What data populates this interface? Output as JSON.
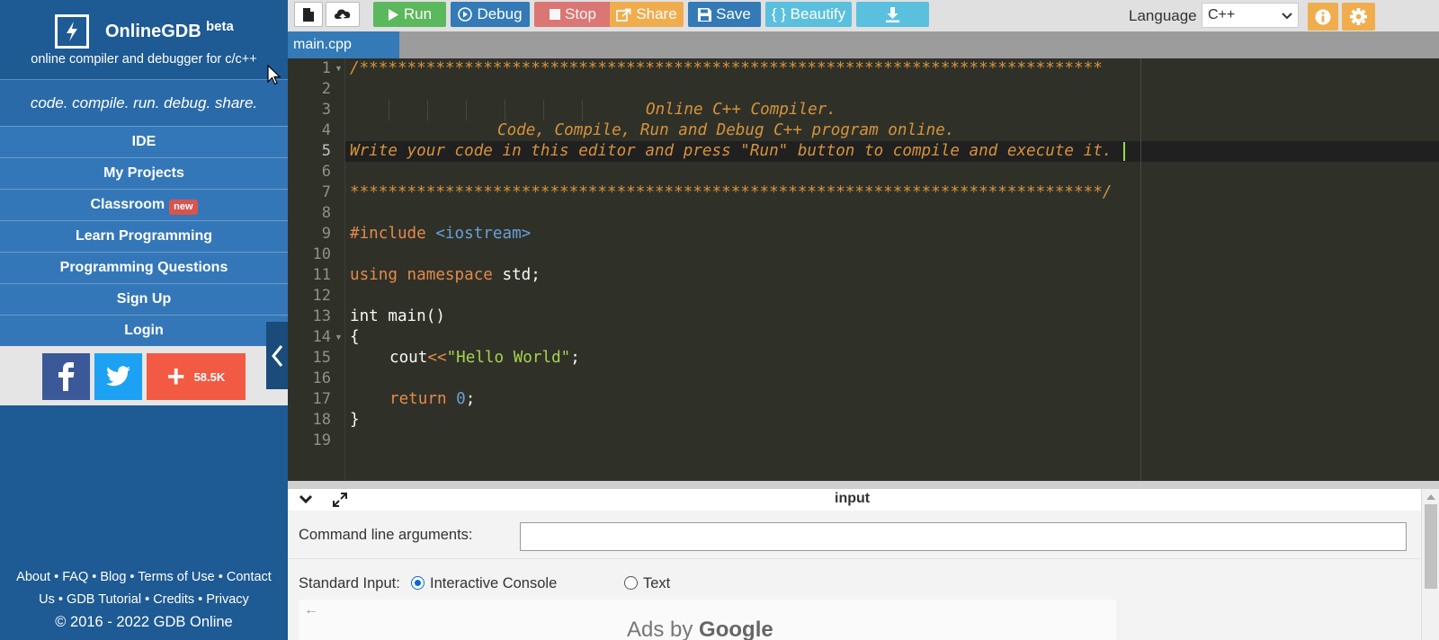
{
  "brand": {
    "name": "OnlineGDB",
    "beta": "beta",
    "tagline": "online compiler and debugger for c/c++",
    "slogan": "code. compile. run. debug. share."
  },
  "nav": {
    "items": [
      {
        "label": "IDE"
      },
      {
        "label": "My Projects"
      },
      {
        "label": "Classroom",
        "badge": "new"
      },
      {
        "label": "Learn Programming"
      },
      {
        "label": "Programming Questions"
      },
      {
        "label": "Sign Up"
      },
      {
        "label": "Login"
      }
    ]
  },
  "social": {
    "share_count": "58.5K",
    "icons": [
      "facebook-icon",
      "twitter-icon",
      "plus-icon"
    ]
  },
  "footer": {
    "links": [
      "About",
      "FAQ",
      "Blog",
      "Terms of Use",
      "Contact Us",
      "GDB Tutorial",
      "Credits",
      "Privacy"
    ],
    "contact_a": "Contact",
    "contact_b": "Us",
    "copyright": "© 2016 - 2022 GDB Online"
  },
  "toolbar": {
    "run": "Run",
    "debug": "Debug",
    "stop": "Stop",
    "share": "Share",
    "save": "Save",
    "beautify": "{ } Beautify",
    "language_label": "Language",
    "language_value": "C++"
  },
  "colors": {
    "sidebar": "#1e5a93",
    "nav_item": "#3477b8",
    "run": "#5cb85c",
    "debug": "#337ab7",
    "stop": "#d9534f",
    "share": "#f0ad4e",
    "beautify": "#5bc0de",
    "editor_bg": "#2f3129"
  },
  "file_tab": {
    "name": "main.cpp"
  },
  "editor": {
    "line_numbers": [
      "1",
      "2",
      "3",
      "4",
      "5",
      "6",
      "7",
      "8",
      "9",
      "10",
      "11",
      "12",
      "13",
      "14",
      "15",
      "16",
      "17",
      "18",
      "19"
    ],
    "active_line": "5",
    "code": {
      "l1": "/******************************************************************************",
      "l3": "Online C++ Compiler.",
      "l4": "Code, Compile, Run and Debug C++ program online.",
      "l5": "Write your code in this editor and press \"Run\" button to compile and execute it.",
      "l7": "*******************************************************************************/",
      "l9_kw": "#include",
      "l9_inc": "<iostream>",
      "l11_kw": "using namespace",
      "l11_id": "std;",
      "l13": "int main()",
      "l14": "{",
      "l15_id": "cout",
      "l15_op": "<<",
      "l15_str": "\"Hello World\"",
      "l15_end": ";",
      "l17_kw": "return",
      "l17_num": "0",
      "l17_end": ";",
      "l18": "}"
    }
  },
  "io": {
    "title": "input",
    "args_label": "Command line arguments:",
    "args_value": "",
    "stdin_label": "Standard Input:",
    "option_console": "Interactive Console",
    "option_text": "Text",
    "selected": "Interactive Console",
    "ad_prefix": "Ads by",
    "ad_brand": "Google"
  }
}
